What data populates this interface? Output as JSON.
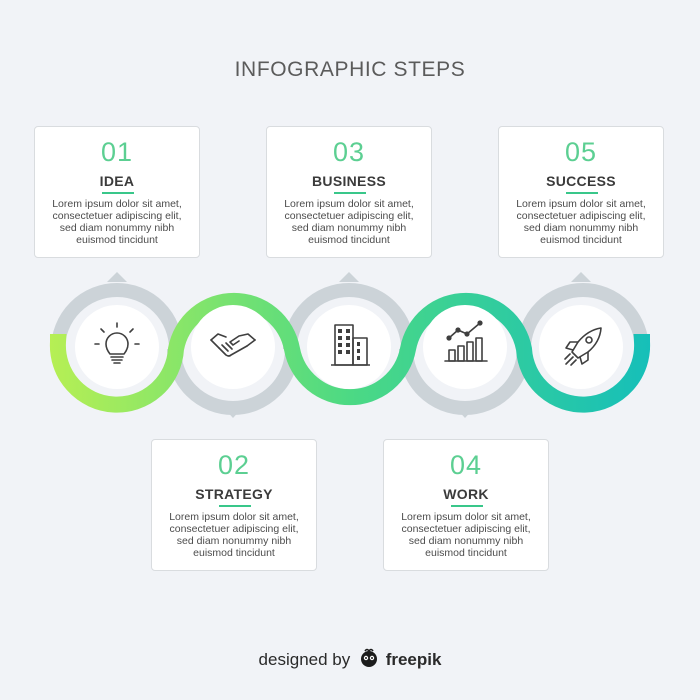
{
  "title": "INFOGRAPHIC STEPS",
  "steps": [
    {
      "num": "01",
      "label": "IDEA",
      "icon": "lightbulb-icon",
      "line1": "Lorem ipsum dolor sit amet,",
      "line2": "consectetuer adipiscing elit,",
      "line3": "sed diam nonummy nibh",
      "line4": "euismod tincidunt"
    },
    {
      "num": "02",
      "label": "STRATEGY",
      "icon": "handshake-icon",
      "line1": "Lorem ipsum dolor sit amet,",
      "line2": "consectetuer adipiscing elit,",
      "line3": "sed diam nonummy nibh",
      "line4": "euismod tincidunt"
    },
    {
      "num": "03",
      "label": "BUSINESS",
      "icon": "building-icon",
      "line1": "Lorem ipsum dolor sit amet,",
      "line2": "consectetuer adipiscing elit,",
      "line3": "sed diam nonummy nibh",
      "line4": "euismod tincidunt"
    },
    {
      "num": "04",
      "label": "WORK",
      "icon": "chart-icon",
      "line1": "Lorem ipsum dolor sit amet,",
      "line2": "consectetuer adipiscing elit,",
      "line3": "sed diam nonummy nibh",
      "line4": "euismod tincidunt"
    },
    {
      "num": "05",
      "label": "SUCCESS",
      "icon": "rocket-icon",
      "line1": "Lorem ipsum dolor sit amet,",
      "line2": "consectetuer adipiscing elit,",
      "line3": "sed diam nonummy nibh",
      "line4": "euismod tincidunt"
    }
  ],
  "credit": {
    "prefix": "designed by",
    "brand": "freepik"
  },
  "colors": {
    "accent_start": "#b6ef54",
    "accent_mid": "#4cd984",
    "accent_end": "#16bfb9",
    "number": "#5ccf92",
    "underline": "#39c78a",
    "ring_gray": "#ccd3d8",
    "background": "#f1f3f7"
  }
}
